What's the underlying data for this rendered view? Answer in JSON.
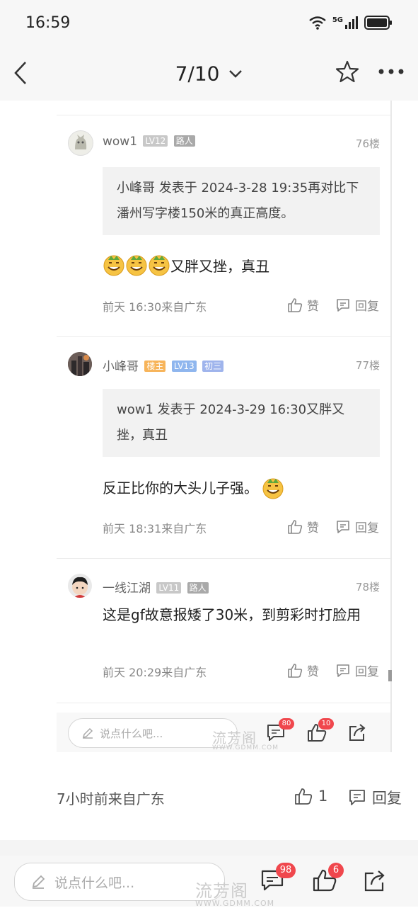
{
  "status": {
    "time": "16:59",
    "network": "5G"
  },
  "nav": {
    "page": "7/10"
  },
  "comments": [
    {
      "user": "wow1",
      "level": "LV12",
      "tag": "路人",
      "floor": "76楼",
      "quote": "小峰哥 发表于 2024-3-28 19:35再对比下潘州写字楼150米的真正高度。",
      "text": "又胖又挫，真丑",
      "time": "前天 16:30来自广东",
      "like": "赞",
      "reply": "回复"
    },
    {
      "user": "小峰哥",
      "owner_badge": "楼主",
      "level": "LV13",
      "tag": "初三",
      "floor": "77楼",
      "quote": "wow1 发表于 2024-3-29 16:30又胖又挫，真丑",
      "text": "反正比你的大头儿子强。",
      "time": "前天 18:31来自广东",
      "like": "赞",
      "reply": "回复"
    },
    {
      "user": "一线江湖",
      "level": "LV11",
      "tag": "路人",
      "floor": "78楼",
      "text": "这是gf故意报矮了30米，到剪彩时打脸用",
      "time": "前天 20:29来自广东",
      "like": "赞",
      "reply": "回复"
    }
  ],
  "embedded_footer": {
    "placeholder": "说点什么吧...",
    "comment_count": "80",
    "like_count": "10"
  },
  "watermark": {
    "brand": "流芳阁",
    "url": "WWW.GDMM.COM"
  },
  "parent": {
    "time": "7小时前来自广东",
    "likes": "1",
    "reply": "回复"
  },
  "bottom_bar": {
    "placeholder": "说点什么吧...",
    "comment_count": "98",
    "like_count": "6"
  },
  "colors": {
    "badge_red": "#f0474d",
    "text_gray": "#888888"
  }
}
